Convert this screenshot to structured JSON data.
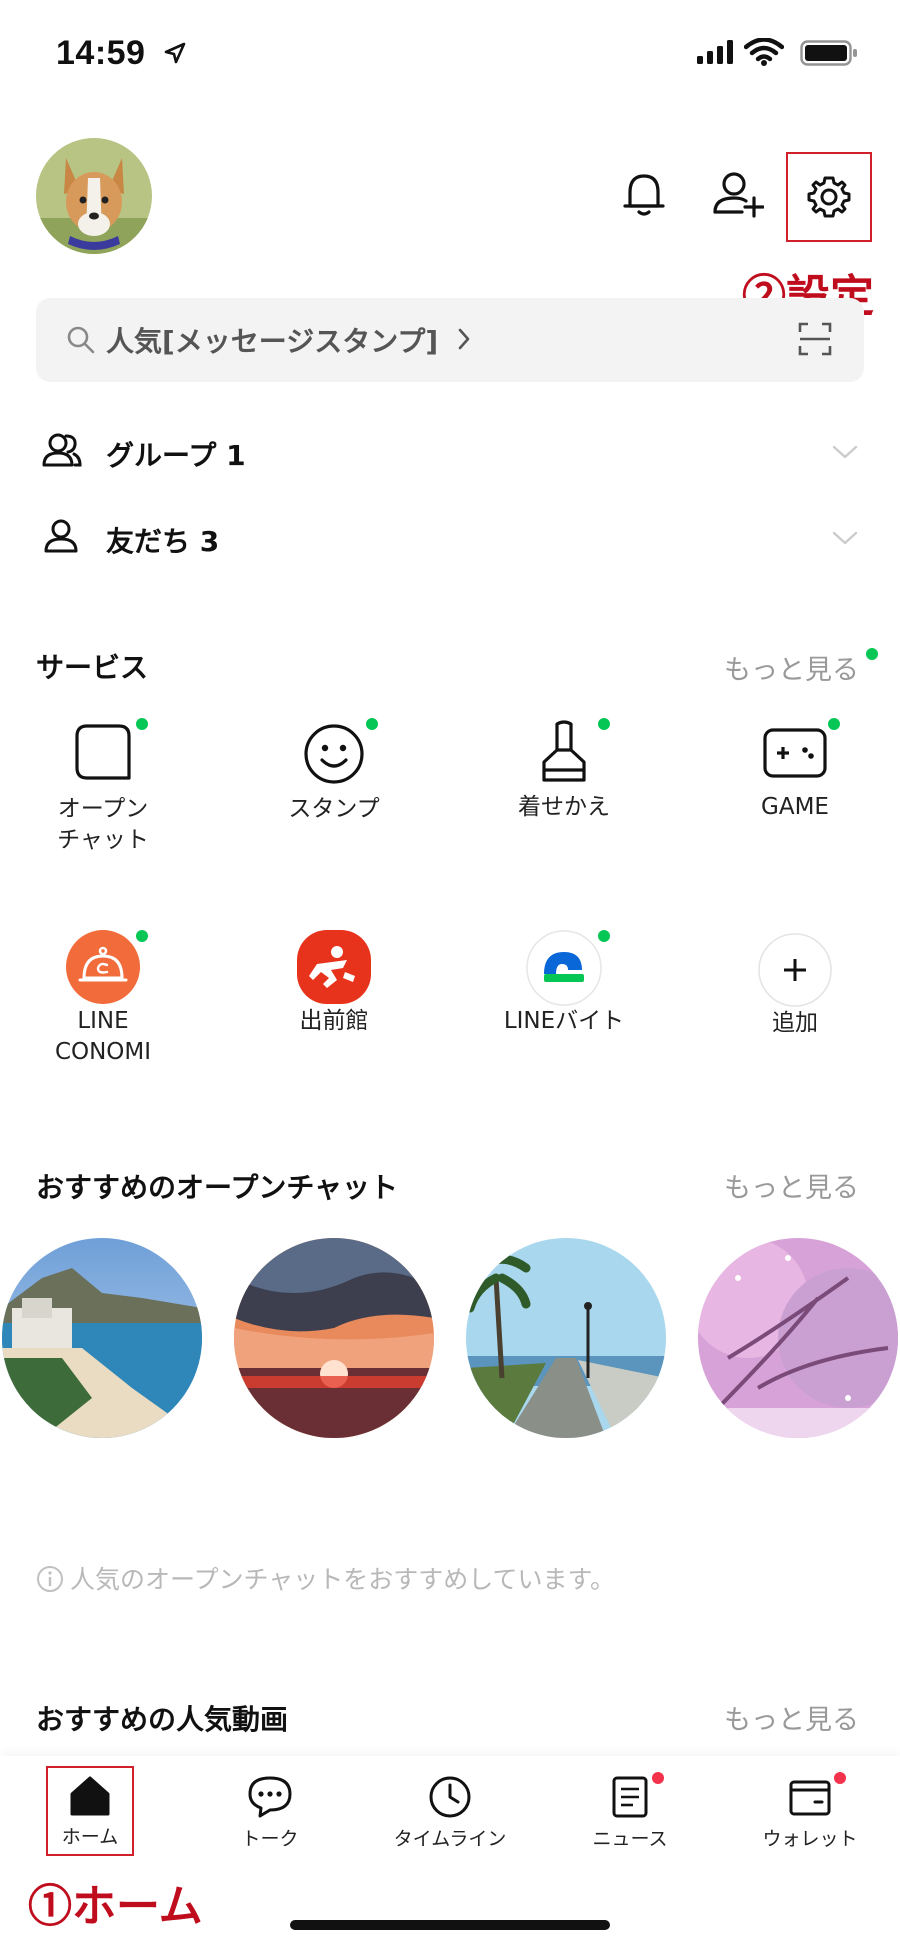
{
  "status_bar": {
    "time": "14:59"
  },
  "header": {
    "settings_annotation": "②設定"
  },
  "search": {
    "text": "人気[メッセージスタンプ]"
  },
  "friends": {
    "groups_label": "グループ 1",
    "friends_label": "友だち 3"
  },
  "services": {
    "title": "サービス",
    "more_label": "もっと見る",
    "items": [
      {
        "label_line1": "オープン",
        "label_line2": "チャット",
        "icon": "open-chat-icon"
      },
      {
        "label_line1": "スタンプ",
        "label_line2": "",
        "icon": "sticker-icon"
      },
      {
        "label_line1": "着せかえ",
        "label_line2": "",
        "icon": "theme-brush-icon"
      },
      {
        "label_line1": "GAME",
        "label_line2": "",
        "icon": "game-icon"
      },
      {
        "label_line1": "LINE",
        "label_line2": "CONOMI",
        "icon": "conomi-icon",
        "color": "#f26b3a"
      },
      {
        "label_line1": "出前館",
        "label_line2": "",
        "icon": "demaecan-icon",
        "color": "#e8331c"
      },
      {
        "label_line1": "LINEバイト",
        "label_line2": "",
        "icon": "linebaito-icon"
      },
      {
        "label_line1": "追加",
        "label_line2": "",
        "icon": "add-icon"
      }
    ]
  },
  "open_chats": {
    "title": "おすすめのオープンチャット",
    "more_label": "もっと見る",
    "items": [
      {
        "image": "beach-photo"
      },
      {
        "image": "sunset-photo"
      },
      {
        "image": "palm-walkway-photo"
      },
      {
        "image": "cherry-blossom-photo"
      }
    ]
  },
  "info_text": "人気のオープンチャットをおすすめしています。",
  "videos": {
    "title": "おすすめの人気動画",
    "more_label": "もっと見る"
  },
  "bottom_nav": {
    "items": [
      {
        "label": "ホーム",
        "icon": "home-icon"
      },
      {
        "label": "トーク",
        "icon": "chat-bubble-icon"
      },
      {
        "label": "タイムライン",
        "icon": "clock-icon"
      },
      {
        "label": "ニュース",
        "icon": "news-icon"
      },
      {
        "label": "ウォレット",
        "icon": "wallet-icon"
      }
    ],
    "home_annotation": "①ホーム"
  },
  "colors": {
    "accent_green": "#06c755",
    "annotation_red": "#c00d1e",
    "badge_red": "#f3334b"
  }
}
